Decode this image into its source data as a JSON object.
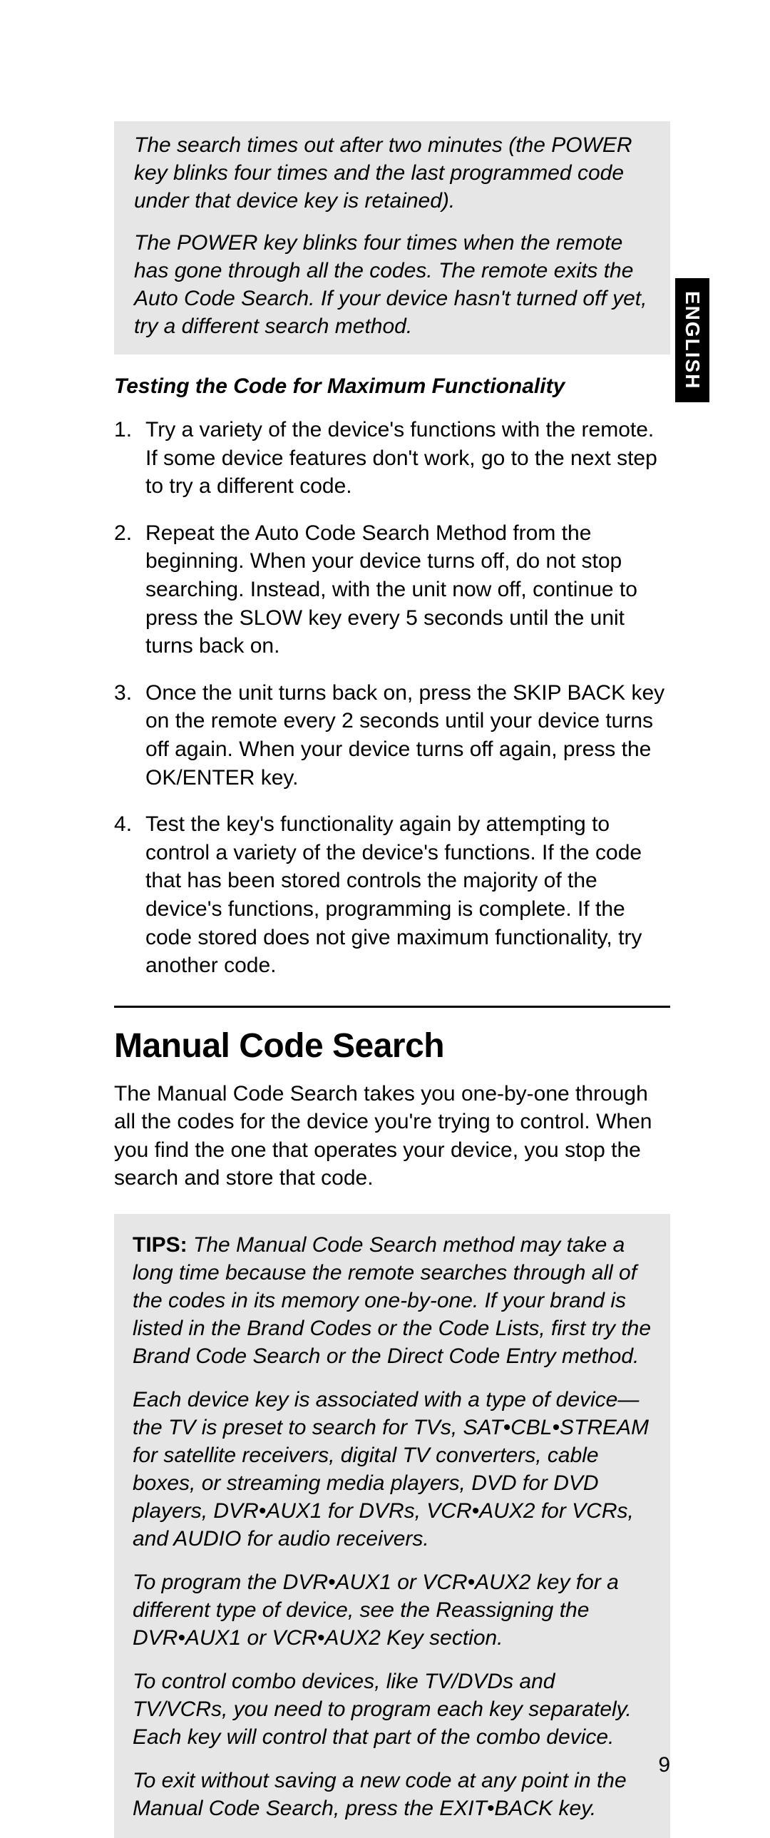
{
  "sideTab": "ENGLISH",
  "topNotes": {
    "p1": "The search times out after two minutes (the POWER key blinks four times and the last programmed code under that device key is retained).",
    "p2": "The POWER key blinks four times when the remote has gone through all the codes. The remote exits the Auto Code Search. If your device hasn't turned off yet, try a different search method."
  },
  "testingHead": "Testing the Code for Maximum Functionality",
  "steps": {
    "s1": "Try a variety of the device's functions with the remote. If some device features don't work, go to the next step to try a different code.",
    "s2": "Repeat the Auto Code Search Method from the beginning. When your device turns off, do not stop searching. Instead, with the unit now off, continue to press the SLOW key every 5 seconds until the unit turns back on.",
    "s3": "Once the unit turns back on, press the SKIP BACK key on the remote every 2 seconds until your device turns off again. When your device turns off again, press the OK/ENTER key.",
    "s4": "Test the key's functionality again by attempting to control a variety of the device's functions. If the code that has been stored controls the majority of the device's functions, programming is complete. If the code stored does not give maximum functionality, try another code."
  },
  "sectionTitle": "Manual Code Search",
  "sectionIntro": "The Manual Code Search takes you one-by-one through all the codes for the device you're trying to control. When you find the one that operates your device, you stop the search and store that code.",
  "tips": {
    "label": "TIPS:",
    "p1": " The Manual Code Search method may take a long time because the remote searches through all of the codes in its memory one-by-one. If your brand is listed in the Brand Codes or the Code Lists, first try the Brand Code Search or the Direct Code Entry method.",
    "p2": "Each device key is associated with a type of device—the TV is preset to search for TVs, SAT•CBL•STREAM for satellite receivers, digital TV converters, cable boxes, or streaming media players, DVD for DVD players, DVR•AUX1 for DVRs, VCR•AUX2 for VCRs, and AUDIO for audio receivers.",
    "p3": "To program the DVR•AUX1 or VCR•AUX2 key for a different type of device, see the Reassigning the DVR•AUX1 or VCR•AUX2 Key section.",
    "p4": "To control combo devices, like TV/DVDs and TV/VCRs, you need to program each key separately. Each key will control that part of the combo device.",
    "p5": "To exit without saving a new code at any point in the Manual Code Search, press the EXIT•BACK key."
  },
  "pageNumber": "9"
}
